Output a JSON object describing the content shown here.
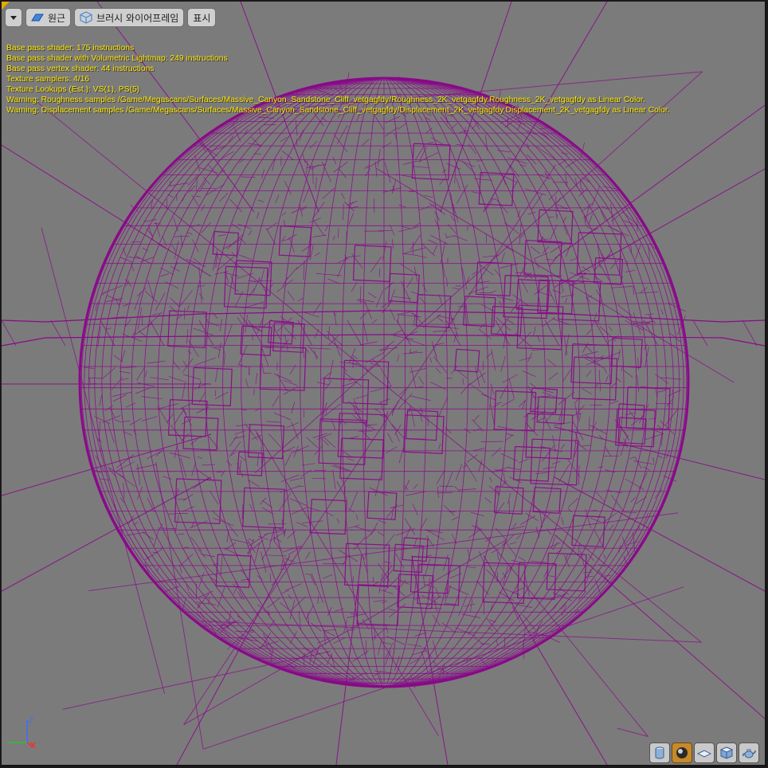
{
  "toolbar": {
    "dropdown_label": "",
    "perspective_label": "원근",
    "brush_wireframe_label": "브러시 와이어프레임",
    "show_label": "표시"
  },
  "stats": {
    "lines": [
      "Base pass shader: 175 instructions",
      "Base pass shader with Volumetric Lightmap: 249 instructions",
      "Base pass vertex shader: 44 instructions",
      "Texture samplers: 4/16",
      "Texture Lookups (Est.): VS(1), PS(5)",
      "Warning: Roughness samples /Game/Megascans/Surfaces/Massive_Canyon_Sandstone_Cliff_vetgagfdy/Roughness_2K_vetgagfdy.Roughness_2K_vetgagfdy as Linear Color.",
      "Warning: Displacement samples /Game/Megascans/Surfaces/Massive_Canyon_Sandstone_Cliff_vetgagfdy/Displacement_2K_vetgagfdy.Displacement_2K_vetgagfdy as Linear Color."
    ]
  },
  "axis": {
    "z_label": "Z"
  },
  "colors": {
    "wireframe": "#8a0a8a",
    "background": "#7b7b7b",
    "stats_text": "#ffe800",
    "accent": "#e8a800"
  },
  "preview_shapes": [
    {
      "icon": "cylinder-icon",
      "active": false
    },
    {
      "icon": "sphere-icon",
      "active": true
    },
    {
      "icon": "plane-icon",
      "active": false
    },
    {
      "icon": "cube-icon",
      "active": false
    },
    {
      "icon": "teapot-icon",
      "active": false
    }
  ]
}
